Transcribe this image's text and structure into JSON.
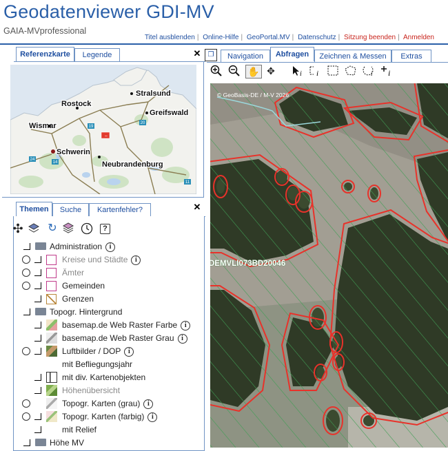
{
  "app": {
    "title": "Geodatenviewer GDI-MV",
    "subtitle": "GAIA-MVprofessional"
  },
  "top_links": [
    {
      "label": "Titel ausblenden",
      "color": "#1f4fa0"
    },
    {
      "label": "Online-Hilfe",
      "color": "#1f4fa0"
    },
    {
      "label": "GeoPortal.MV",
      "color": "#1f4fa0"
    },
    {
      "label": "Datenschutz",
      "color": "#1f4fa0"
    },
    {
      "label": "Sitzung beenden",
      "color": "#c8241c"
    },
    {
      "label": "Anmelden",
      "color": "#c8241c"
    }
  ],
  "overview": {
    "tabs": [
      "Referenzkarte",
      "Legende"
    ],
    "active_tab": "Referenzkarte",
    "cities": [
      "Stralsund",
      "Rostock",
      "Greifswald",
      "Wismar",
      "Schwerin",
      "Neubrandenburg"
    ],
    "road_numbers": [
      "19",
      "20",
      "24",
      "14",
      "11"
    ]
  },
  "themes": {
    "tabs": [
      "Themen",
      "Suche",
      "Kartenfehler?"
    ],
    "active_tab": "Themen",
    "toolbar_icons": [
      "add-layer-icon",
      "layers-icon",
      "refresh-icon",
      "layers-stack-icon",
      "clock-icon",
      "help-icon"
    ],
    "help_glyph": "?",
    "info_glyph": "i",
    "items": [
      {
        "label": "Administration",
        "info": true
      },
      {
        "label": "Kreise und Städte",
        "info": true
      },
      {
        "label": "Ämter",
        "info": false
      },
      {
        "label": "Gemeinden",
        "info": false
      },
      {
        "label": "Grenzen",
        "info": false
      },
      {
        "label": "Topogr. Hintergrund",
        "info": false
      },
      {
        "label": "basemap.de Web Raster Farbe",
        "info": true
      },
      {
        "label": "basemap.de Web Raster Grau",
        "info": true
      },
      {
        "label": "Luftbilder / DOP",
        "info": true
      },
      {
        "label": "mit Befliegungsjahr",
        "info": false
      },
      {
        "label": "mit div. Kartenobjekten",
        "info": false
      },
      {
        "label": "Höhenübersicht",
        "info": false
      },
      {
        "label": "Topogr. Karten (grau)",
        "info": true
      },
      {
        "label": "Topogr. Karten (farbig)",
        "info": true
      },
      {
        "label": "mit Relief",
        "info": false
      },
      {
        "label": "Höhe MV",
        "info": false
      }
    ]
  },
  "main": {
    "tabs": [
      "Navigation",
      "Abfragen",
      "Zeichnen & Messen",
      "Extras"
    ],
    "active_tab": "Abfragen",
    "tools": [
      "zoom-in-icon",
      "zoom-out-icon",
      "pan-hand-icon",
      "full-extent-icon",
      "info-pointer-icon",
      "info-multi-icon",
      "select-rect-icon",
      "select-poly-icon",
      "select-circle-icon",
      "info-point-icon"
    ],
    "copyright": "© GeoBasis-DE / M-V 2026",
    "feature_label": "DEMVLI073BD20046",
    "colors": {
      "outline": "#e8322a",
      "hatch": "#4aa35a"
    }
  }
}
